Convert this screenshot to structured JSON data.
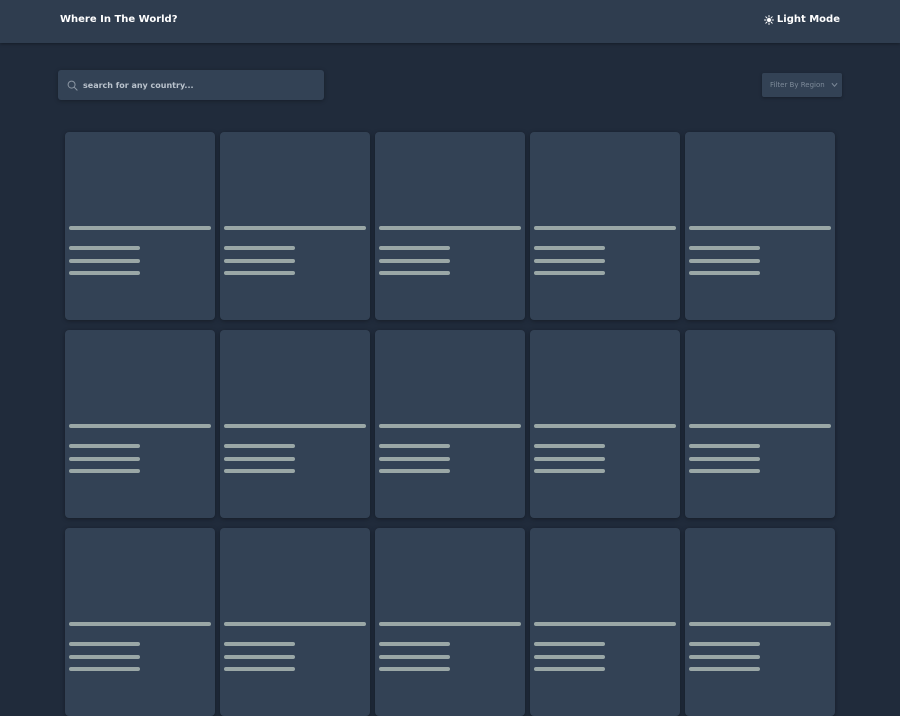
{
  "header": {
    "title": "Where In The World?",
    "mode_icon": "sun-icon",
    "mode_label": "Light Mode"
  },
  "search": {
    "icon": "search-icon",
    "placeholder": "search for any country...",
    "value": ""
  },
  "filter": {
    "label": "Filter By Region",
    "icon": "chevron-down-icon"
  },
  "cards": {
    "rows": 3,
    "columns": 5,
    "state": "loading-skeleton"
  },
  "colors": {
    "background": "#202b3b",
    "surface": "#2f3d4f",
    "card": "#334255",
    "skeleton": "#9aa7a6",
    "text": "#ffffff"
  }
}
